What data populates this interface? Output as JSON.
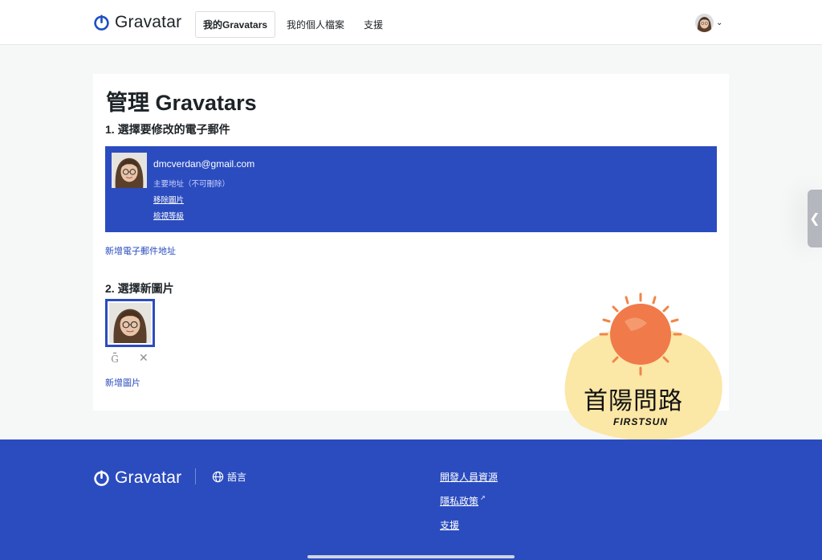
{
  "header": {
    "brand": "Gravatar",
    "nav": [
      {
        "label": "我的Gravatars",
        "active": true
      },
      {
        "label": "我的個人檔案",
        "active": false
      },
      {
        "label": "支援",
        "active": false
      }
    ],
    "account_icon": "user-avatar-icon"
  },
  "main": {
    "title": "管理 Gravatars",
    "step1": "1. 選擇要修改的電子郵件",
    "email": {
      "address": "dmcverdan@gmail.com",
      "primary_note": "主要地址（不可刪除）",
      "remove_image": "移除圖片",
      "view_rating": "檢視等級"
    },
    "add_email": "新增電子郵件地址",
    "step2": "2. 選擇新圖片",
    "rating_icon": "rating-g-icon",
    "rating_letter": "G",
    "delete_icon": "close-icon",
    "add_image": "新增圖片"
  },
  "footer": {
    "brand": "Gravatar",
    "language": "語言",
    "links": [
      "開發人員資源",
      "隱私政策",
      "支援"
    ]
  },
  "watermark": {
    "text": "首陽問路",
    "subtext": "FIRSTSUN"
  },
  "colors": {
    "accent": "#2b4cbf",
    "page_background": "#f6f7f7",
    "card_background": "#ffffff"
  }
}
